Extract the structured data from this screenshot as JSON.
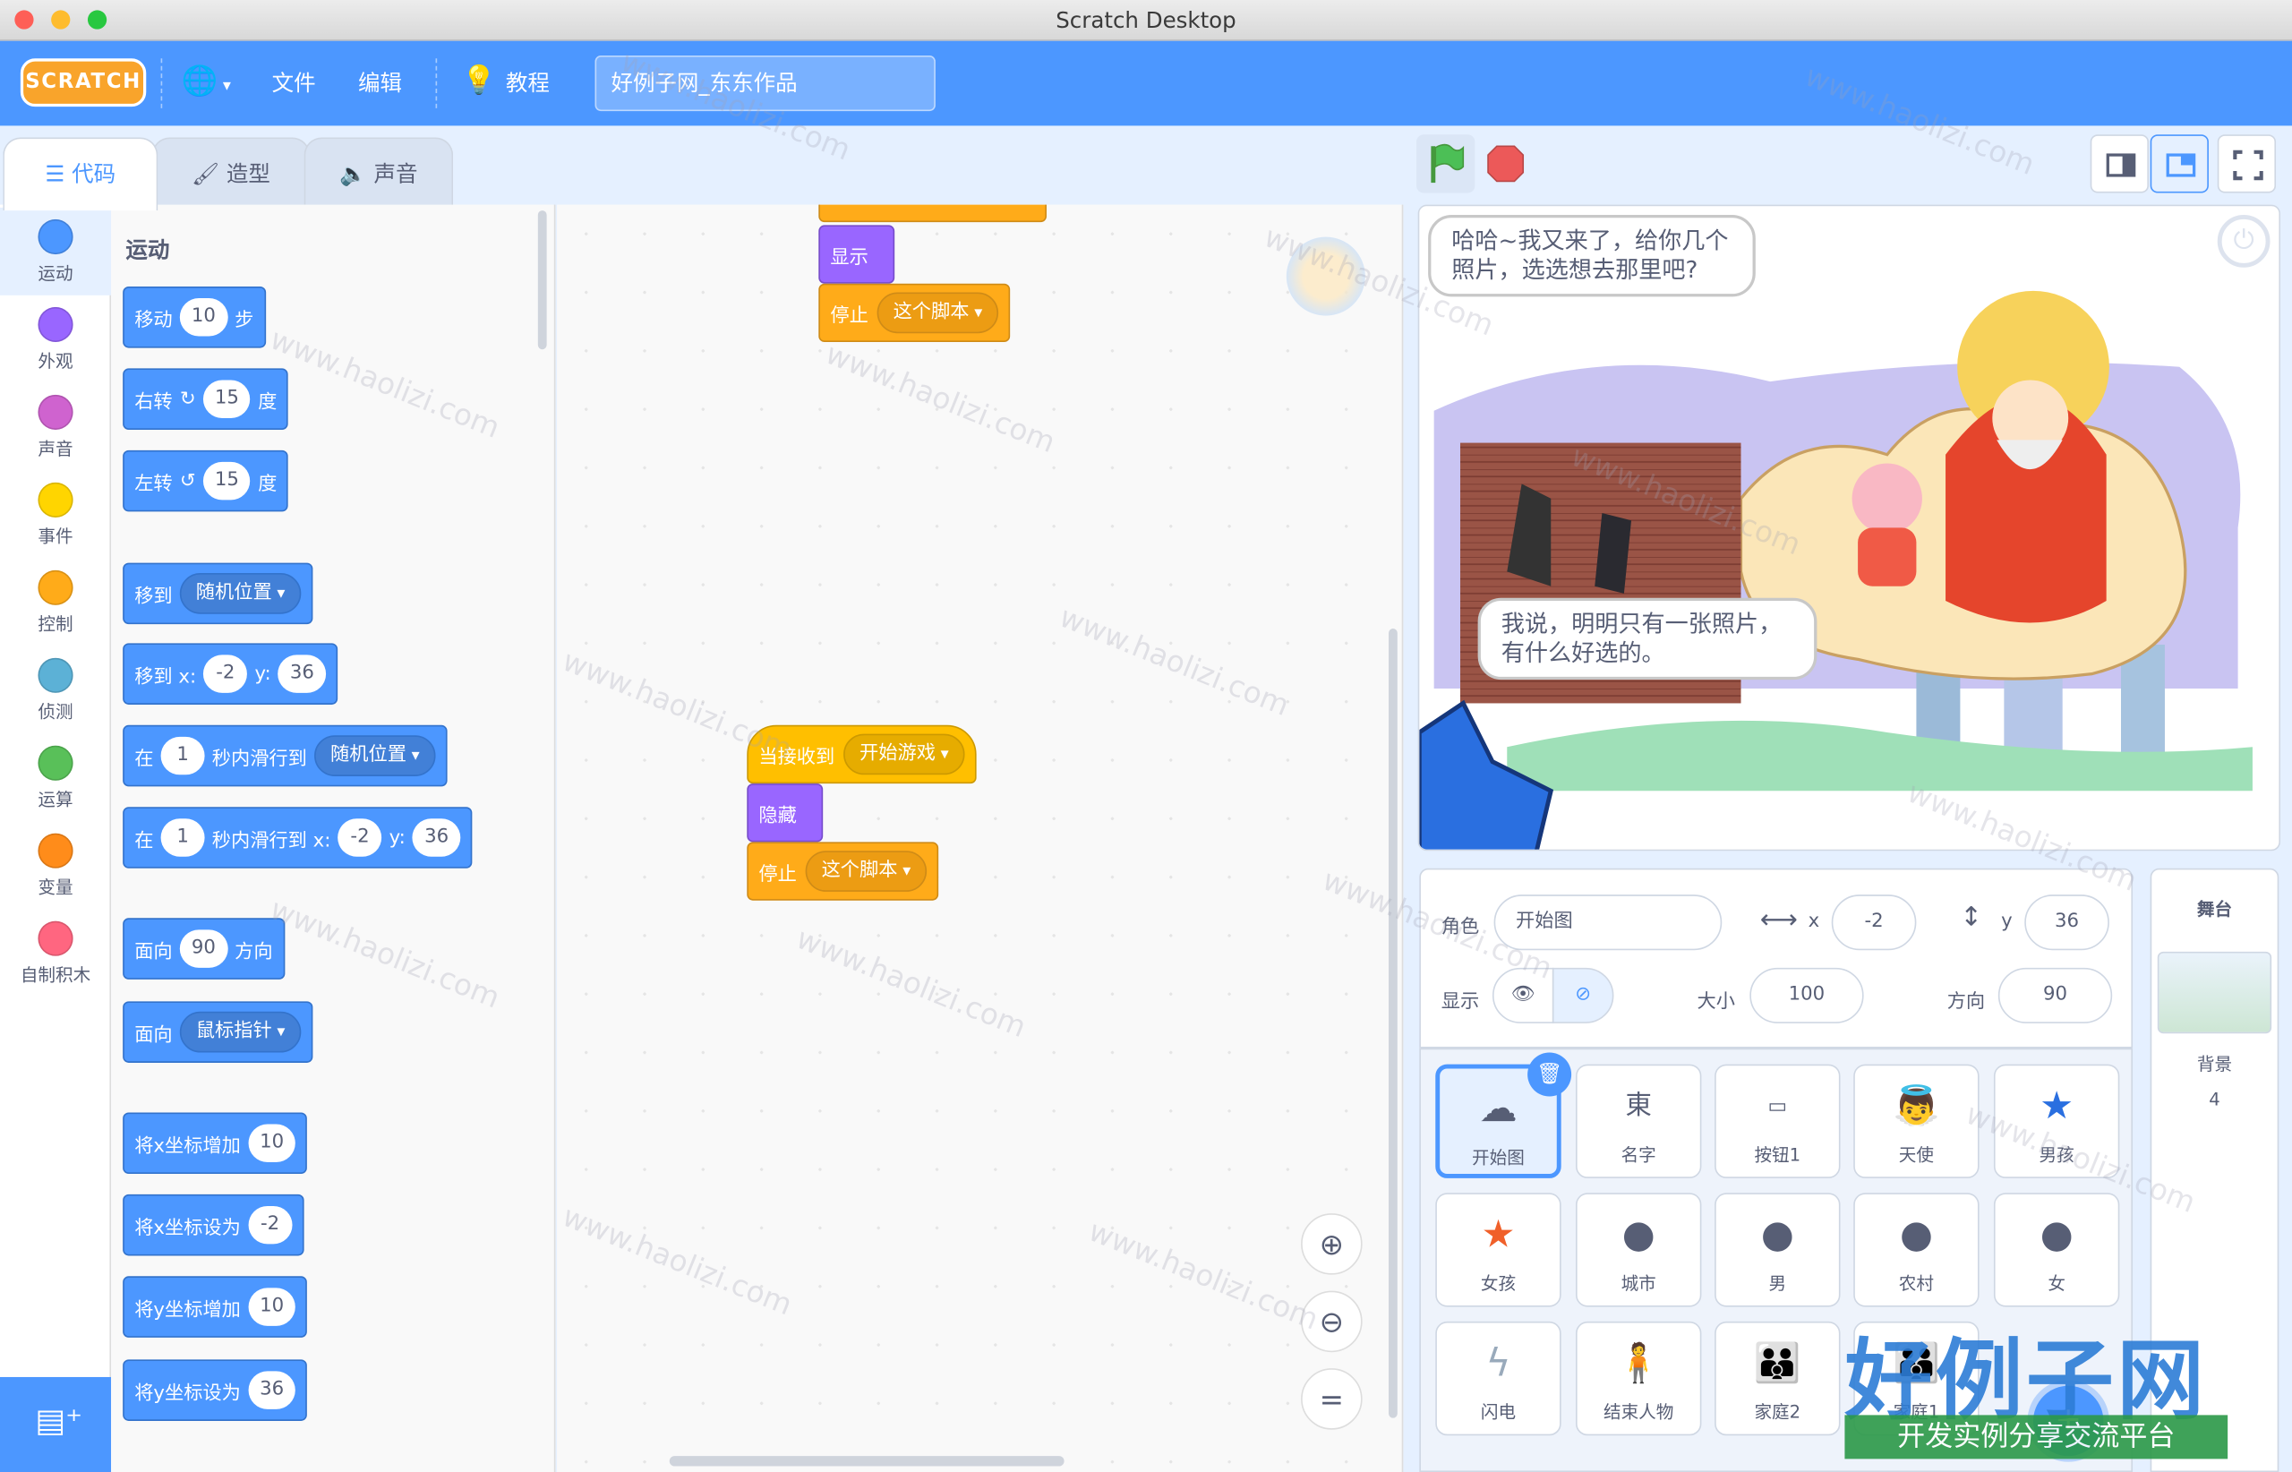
{
  "window": {
    "title": "Scratch Desktop"
  },
  "menu": {
    "logo": "SCRATCH",
    "file": "文件",
    "edit": "编辑",
    "tutorials": "教程",
    "project_title": "好例子网_东东作品"
  },
  "tabs": [
    {
      "label": "代码"
    },
    {
      "label": "造型"
    },
    {
      "label": "声音"
    }
  ],
  "categories": [
    {
      "label": "运动",
      "color": "#4c97ff"
    },
    {
      "label": "外观",
      "color": "#9966ff"
    },
    {
      "label": "声音",
      "color": "#cf63cf"
    },
    {
      "label": "事件",
      "color": "#ffd500"
    },
    {
      "label": "控制",
      "color": "#ffab19"
    },
    {
      "label": "侦测",
      "color": "#5cb1d6"
    },
    {
      "label": "运算",
      "color": "#59c059"
    },
    {
      "label": "变量",
      "color": "#ff8c1a"
    },
    {
      "label": "自制积木",
      "color": "#ff6680"
    }
  ],
  "palette": {
    "title": "运动",
    "move": {
      "a": "移动",
      "v": "10",
      "b": "步"
    },
    "turn_right": {
      "a": "右转",
      "v": "15",
      "b": "度"
    },
    "turn_left": {
      "a": "左转",
      "v": "15",
      "b": "度"
    },
    "goto": {
      "a": "移到",
      "dd": "随机位置"
    },
    "goto_xy": {
      "a": "移到 x:",
      "x": "-2",
      "b": "y:",
      "y": "36"
    },
    "glide": {
      "a": "在",
      "v": "1",
      "b": "秒内滑行到",
      "dd": "随机位置"
    },
    "glide_xy": {
      "a": "在",
      "v": "1",
      "b": "秒内滑行到 x:",
      "x": "-2",
      "c": "y:",
      "y": "36"
    },
    "point_dir": {
      "a": "面向",
      "v": "90",
      "b": "方向"
    },
    "point_towards": {
      "a": "面向",
      "dd": "鼠标指针"
    },
    "change_x": {
      "a": "将x坐标增加",
      "v": "10"
    },
    "set_x": {
      "a": "将x坐标设为",
      "v": "-2"
    },
    "change_y": {
      "a": "将y坐标增加",
      "v": "10"
    },
    "set_y": {
      "a": "将y坐标设为",
      "v": "36"
    }
  },
  "scripts": {
    "s1": {
      "show": "显示",
      "stop": "停止",
      "stop_dd": "这个脚本"
    },
    "s2": {
      "hat": "当接收到",
      "hat_dd": "开始游戏",
      "hide": "隐藏",
      "stop": "停止",
      "stop_dd": "这个脚本"
    }
  },
  "stage": {
    "bubble1": "哈哈~我又来了，给你几个照片，选选想去那里吧?",
    "bubble2": "我说，明明只有一张照片，有什么好选的。"
  },
  "sprite_info": {
    "sprite_label": "角色",
    "sprite_name": "开始图",
    "x_label": "x",
    "x_value": "-2",
    "y_label": "y",
    "y_value": "36",
    "show_label": "显示",
    "size_label": "大小",
    "size_value": "100",
    "dir_label": "方向",
    "dir_value": "90"
  },
  "sprites": [
    {
      "name": "开始图"
    },
    {
      "name": "名字"
    },
    {
      "name": "按钮1"
    },
    {
      "name": "天使"
    },
    {
      "name": "男孩"
    },
    {
      "name": "女孩"
    },
    {
      "name": "城市"
    },
    {
      "name": "男"
    },
    {
      "name": "农村"
    },
    {
      "name": "女"
    },
    {
      "name": "闪电"
    },
    {
      "name": "结束人物"
    },
    {
      "name": "家庭2"
    },
    {
      "name": "家庭1"
    }
  ],
  "stage_pane": {
    "title": "舞台",
    "backdrops_label": "背景",
    "backdrops_count": "4"
  },
  "watermark": {
    "text": "www.haolizi.com",
    "brand": "好例子网",
    "slogan": "开发实例分享交流平台"
  }
}
